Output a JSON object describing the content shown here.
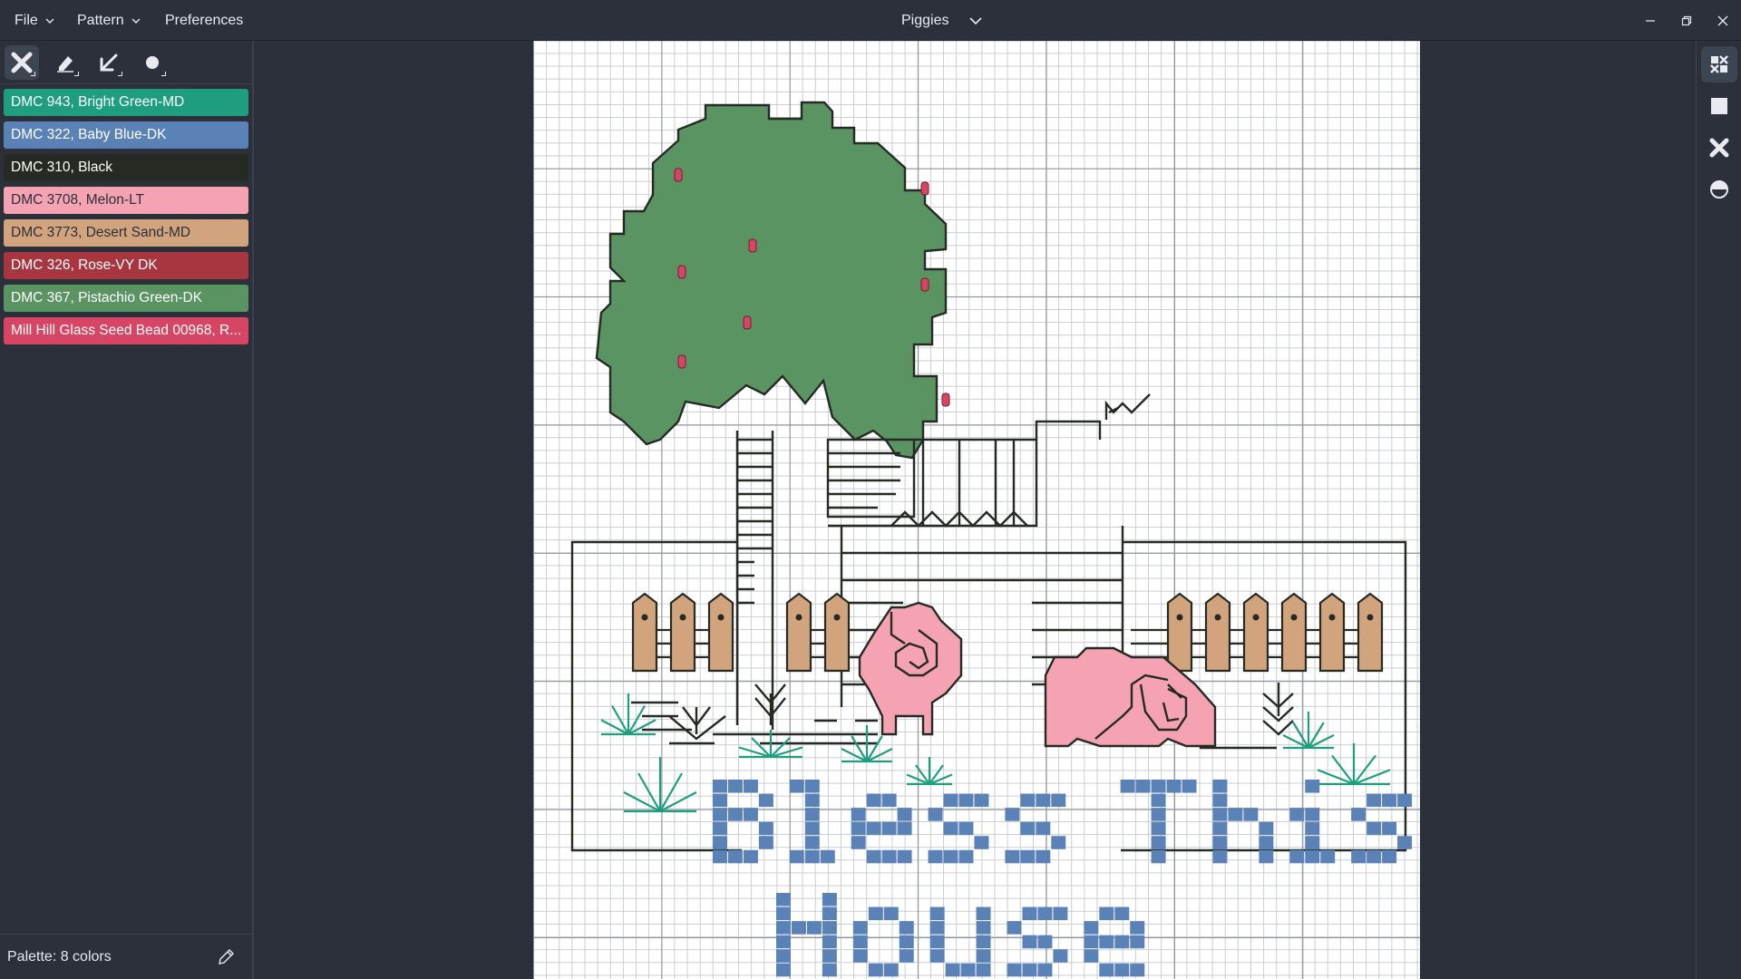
{
  "menu": {
    "file": "File",
    "pattern": "Pattern",
    "preferences": "Preferences"
  },
  "title": "Piggies",
  "tools": [
    {
      "name": "full-stitch-tool",
      "active": true
    },
    {
      "name": "eraser-tool",
      "active": false
    },
    {
      "name": "back-stitch-tool",
      "active": false
    },
    {
      "name": "bead-tool",
      "active": false
    }
  ],
  "palette": {
    "items": [
      {
        "label": "DMC 943, Bright Green-MD",
        "color": "#1e9e7e",
        "text": "#ffffff"
      },
      {
        "label": "DMC 322, Baby Blue-DK",
        "color": "#5a82b6",
        "text": "#ffffff"
      },
      {
        "label": "DMC 310, Black",
        "color": "#252a22",
        "text": "#ffffff"
      },
      {
        "label": "DMC 3708, Melon-LT",
        "color": "#f5a3b2",
        "text": "#2b303b"
      },
      {
        "label": "DMC 3773, Desert Sand-MD",
        "color": "#d2a47e",
        "text": "#2b303b"
      },
      {
        "label": "DMC 326, Rose-VY DK",
        "color": "#a83640",
        "text": "#ffffff"
      },
      {
        "label": "DMC 367, Pistachio Green-DK",
        "color": "#5b9463",
        "text": "#ffffff"
      },
      {
        "label": "Mill Hill Glass Seed Bead 00968, R...",
        "color": "#d74564",
        "text": "#ffffff"
      }
    ],
    "footer": "Palette: 8 colors"
  },
  "right_rail": [
    {
      "name": "stitches-view",
      "active": true
    },
    {
      "name": "solid-view",
      "active": false
    },
    {
      "name": "symbols-view",
      "active": false
    },
    {
      "name": "mixed-view",
      "active": false
    }
  ],
  "pattern_text": {
    "line1": "Bless This",
    "line2": "House"
  },
  "colors": {
    "background": "#2b303b",
    "outline": "#252a22",
    "tree": "#5b9463",
    "pig": "#f5a3b2",
    "fence": "#d2a47e",
    "letters": "#5a82b6",
    "grass": "#1e9e7e",
    "bead": "#d74564"
  }
}
